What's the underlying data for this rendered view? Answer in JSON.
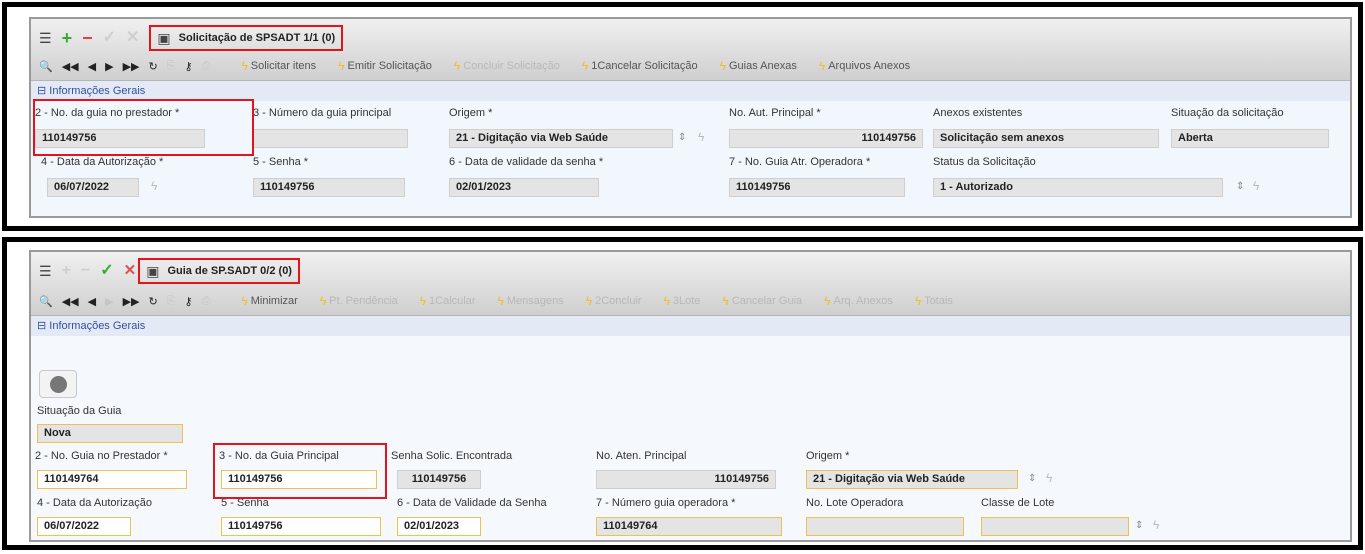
{
  "top": {
    "title": "Solicitação de SPSADT   1/1 (0)",
    "actions": [
      "Solicitar itens",
      "Emitir Solicitação",
      "Concluir Solicitação",
      "1Cancelar Solicitação",
      "Guias Anexas",
      "Arquivos Anexos"
    ],
    "section": "Informações Gerais",
    "labels": {
      "guia_prestador": "2 - No. da guia no prestador *",
      "guia_principal": "3 - Número da guia principal",
      "origem": "Origem *",
      "aut_principal": "No. Aut. Principal *",
      "anexos": "Anexos existentes",
      "situacao": "Situação da solicitação",
      "data_aut": "4 - Data da Autorização *",
      "senha": "5 - Senha *",
      "validade": "6 - Data de validade da senha *",
      "guia_operadora": "7 - No. Guia Atr. Operadora *",
      "status": "Status da Solicitação"
    },
    "values": {
      "guia_prestador": "110149756",
      "guia_principal": "",
      "origem": "21 - Digitação via Web Saúde",
      "aut_principal": "110149756",
      "anexos": "Solicitação sem anexos",
      "situacao": "Aberta",
      "data_aut": "06/07/2022",
      "senha": "110149756",
      "validade": "02/01/2023",
      "guia_operadora": "110149756",
      "status": "1 - Autorizado"
    }
  },
  "bottom": {
    "title": "Guia de SP.SADT   0/2 (0)",
    "actions": [
      "Minimizar",
      "Pt. Pendência",
      "1Calcular",
      "Mensagens",
      "2Concluir",
      "3Lote",
      "Cancelar Guia",
      "Arq. Anexos",
      "Totais"
    ],
    "section": "Informações Gerais",
    "labels": {
      "situacao_guia": "Situação da Guia",
      "guia_prestador": "2 - No. Guia no Prestador *",
      "guia_principal": "3 - No. da Guia Principal",
      "senha_solic": "Senha Solic. Encontrada",
      "aten_principal": "No. Aten. Principal",
      "origem": "Origem *",
      "data_aut": "4 - Data da Autorização",
      "senha": "5 - Senha",
      "validade": "6 - Data de Validade da Senha",
      "guia_operadora": "7 - Número guia operadora *",
      "lote_operadora": "No. Lote Operadora",
      "classe_lote": "Classe de Lote"
    },
    "values": {
      "situacao_guia": "Nova",
      "guia_prestador": "110149764",
      "guia_principal": "110149756",
      "senha_solic": "110149756",
      "aten_principal": "110149756",
      "origem": "21 - Digitação via Web Saúde",
      "data_aut": "06/07/2022",
      "senha": "110149756",
      "validade": "02/01/2023",
      "guia_operadora": "110149764",
      "lote_operadora": "",
      "classe_lote": ""
    }
  },
  "icons": {
    "menu": "menu-icon",
    "add": "plus-icon",
    "remove": "minus-icon",
    "confirm": "check-icon",
    "cancel": "x-icon",
    "save": "save-icon",
    "search": "search-icon",
    "first": "first-icon",
    "prev": "prev-icon",
    "next": "next-icon",
    "last": "last-icon",
    "refresh": "refresh-icon",
    "copy": "copy-icon",
    "key": "key-icon",
    "print": "print-icon",
    "bolt": "lightning-icon"
  },
  "colors": {
    "highlight": "#e3141c",
    "section_text": "#334fa0",
    "section_bg": "#e3eaf5",
    "field_bg": "#e4e4e4",
    "required_border": "#f0c050",
    "bolt": "#f0c020"
  }
}
